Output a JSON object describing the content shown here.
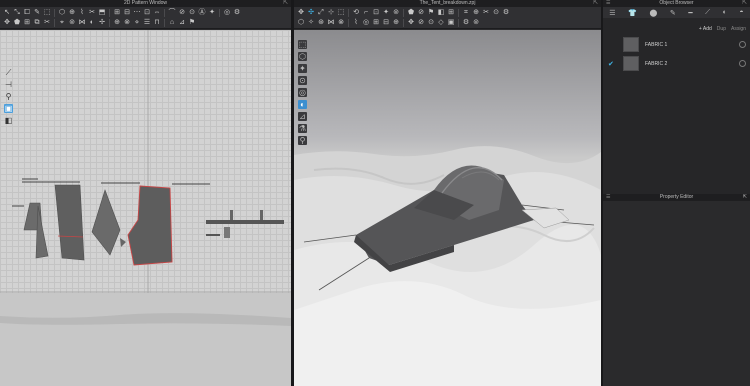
{
  "pattern_window": {
    "title": "2D Pattern Window",
    "toolbar_row1": [
      "↖",
      "⤡",
      "⧠",
      "✎",
      "⬚",
      "⬡",
      "⊕",
      "⌇",
      "✂",
      "⬒",
      "⊞",
      "⊟",
      "⋯",
      "⊡",
      "⇔",
      "⌒",
      "⊘",
      "⊙",
      "Ⓐ",
      "✦",
      "◎",
      "⚙"
    ],
    "toolbar_row2": [
      "✥",
      "⬟",
      "⊞",
      "⧉",
      "✂",
      "⌖",
      "⊚",
      "⋈",
      "◐",
      "✢",
      "⊕",
      "⊗",
      "⋄",
      "☰",
      "⊓",
      "⌂",
      "⊿",
      "⚑"
    ],
    "side_tools": [
      "⟋",
      "⊣",
      "⚲",
      "▣",
      "◧"
    ]
  },
  "viewport": {
    "title": "The_Tent_breakdown.zpj",
    "toolbar_row1": [
      "✥",
      "✣",
      "⤢",
      "⊹",
      "⬚",
      "⟲",
      "⌐",
      "⊡",
      "✦",
      "⊚",
      "⬟",
      "⊘",
      "⚑",
      "◧",
      "⊞",
      "⌗",
      "⊕",
      "✂",
      "⊙",
      "⚙"
    ],
    "toolbar_row2": [
      "⬡",
      "✧",
      "⊛",
      "⋈",
      "⊗",
      "⌇",
      "◎",
      "⊞",
      "⊟",
      "⊕",
      "✥",
      "⊘",
      "⊙",
      "◇",
      "▣",
      "⚙",
      "⊚"
    ],
    "side_tools": [
      "⬚",
      "⬡",
      "✦",
      "⊙",
      "◎",
      "◐",
      "⊿",
      "⚗",
      "⚲"
    ]
  },
  "object_browser": {
    "title": "Object Browser",
    "tabs": [
      "☰",
      "👕",
      "⬤",
      "✎",
      "━",
      "⟋",
      "◐",
      "◓"
    ],
    "add_label": "+ Add",
    "action2": "Dup",
    "action3": "Assign",
    "fabrics": [
      {
        "name": "FABRIC 1",
        "checked": false
      },
      {
        "name": "FABRIC 2",
        "checked": true
      }
    ]
  },
  "property_editor": {
    "title": "Property Editor"
  }
}
